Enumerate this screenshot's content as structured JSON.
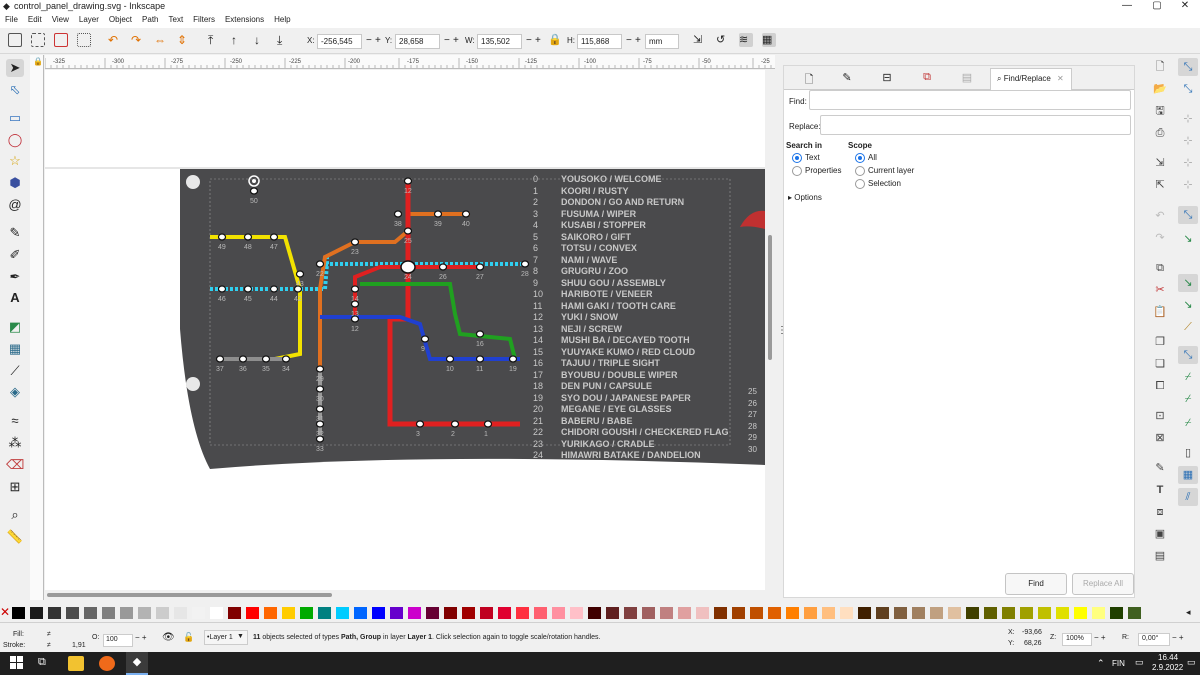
{
  "window": {
    "title": "control_panel_drawing.svg - Inkscape",
    "minimize": "—",
    "maximize": "▢",
    "close": "✕"
  },
  "menu": [
    "File",
    "Edit",
    "View",
    "Layer",
    "Object",
    "Path",
    "Text",
    "Filters",
    "Extensions",
    "Help"
  ],
  "toolbar": {
    "x_label": "X:",
    "x_value": "-256,545",
    "y_label": "Y:",
    "y_value": "28,658",
    "w_label": "W:",
    "w_value": "135,502",
    "h_label": "H:",
    "h_value": "115,868",
    "unit": "mm"
  },
  "ruler_ticks": [
    "-325",
    "-300",
    "-275",
    "-250",
    "-225",
    "-200",
    "-175",
    "-150",
    "-125",
    "-100",
    "-75",
    "-50",
    "-25"
  ],
  "map": {
    "legend": [
      {
        "n": "0",
        "t": "YOUSOKO / WELCOME"
      },
      {
        "n": "1",
        "t": "KOORI / RUSTY"
      },
      {
        "n": "2",
        "t": "DONDON / GO AND RETURN"
      },
      {
        "n": "3",
        "t": "FUSUMA / WIPER"
      },
      {
        "n": "4",
        "t": "KUSABI / STOPPER"
      },
      {
        "n": "5",
        "t": "SAIKORO / GIFT"
      },
      {
        "n": "6",
        "t": "TOTSU / CONVEX"
      },
      {
        "n": "7",
        "t": "NAMI / WAVE"
      },
      {
        "n": "8",
        "t": "GRUGRU / ZOO"
      },
      {
        "n": "9",
        "t": "SHUU GOU / ASSEMBLY"
      },
      {
        "n": "10",
        "t": "HARIBOTE / VENEER"
      },
      {
        "n": "11",
        "t": "HAMI GAKI / TOOTH CARE"
      },
      {
        "n": "12",
        "t": "YUKI / SNOW"
      },
      {
        "n": "13",
        "t": "NEJI / SCREW"
      },
      {
        "n": "14",
        "t": "MUSHI BA / DECAYED TOOTH"
      },
      {
        "n": "15",
        "t": "YUUYAKE KUMO / RED CLOUD"
      },
      {
        "n": "16",
        "t": "TAJUU / TRIPLE SIGHT"
      },
      {
        "n": "17",
        "t": "BYOUBU / DOUBLE WIPER"
      },
      {
        "n": "18",
        "t": "DEN PUN / CAPSULE"
      },
      {
        "n": "19",
        "t": "SYO DOU / JAPANESE PAPER"
      },
      {
        "n": "20",
        "t": "MEGANE / EYE GLASSES"
      },
      {
        "n": "21",
        "t": "BABERU / BABE"
      },
      {
        "n": "22",
        "t": "CHIDORI GOUSHI / CHECKERED FLAG"
      },
      {
        "n": "23",
        "t": "YURIKAGO / CRADLE"
      },
      {
        "n": "24",
        "t": "HIMAWRI BATAKE / DANDELION"
      }
    ],
    "right_numbers": [
      "25",
      "26",
      "27",
      "28",
      "29",
      "30"
    ],
    "station_labels": [
      "50",
      "49",
      "48",
      "47",
      "46",
      "45",
      "44",
      "43",
      "42",
      "37",
      "36",
      "35",
      "34",
      "12",
      "38",
      "39",
      "40",
      "25",
      "22",
      "23",
      "24",
      "26",
      "27",
      "28",
      "14",
      "13",
      "12",
      "9",
      "16",
      "10",
      "11",
      "19",
      "3",
      "2",
      "1",
      "29",
      "30",
      "31",
      "32",
      "33"
    ]
  },
  "find_panel": {
    "tab_label": "Find/Replace",
    "find_label": "Find:",
    "replace_label": "Replace:",
    "search_in_label": "Search in",
    "scope_label": "Scope",
    "search_in": [
      "Text",
      "Properties"
    ],
    "scope": [
      "All",
      "Current layer",
      "Selection"
    ],
    "options_label": "Options",
    "find_button": "Find",
    "replace_all_button": "Replace All"
  },
  "status": {
    "fill_label": "Fill:",
    "fill_value": "≠",
    "stroke_label": "Stroke:",
    "stroke_value": "≠",
    "stroke_width": "1,91",
    "opacity_label": "O:",
    "opacity_value": "100",
    "layer": "•Layer 1",
    "message_bold1": "11",
    "message_part1": " objects selected of types ",
    "message_bold2": "Path, Group",
    "message_part2": " in layer ",
    "message_bold3": "Layer 1",
    "message_part3": ". Click selection again to toggle scale/rotation handles.",
    "cx_label": "X:",
    "cx_value": "-93,66",
    "cy_label": "Y:",
    "cy_value": "68,26",
    "zoom_label": "Z:",
    "zoom_value": "100%",
    "rot_label": "R:",
    "rot_value": "0,00°"
  },
  "taskbar": {
    "lang": "FIN",
    "time": "16.44",
    "date": "2.9.2022"
  }
}
